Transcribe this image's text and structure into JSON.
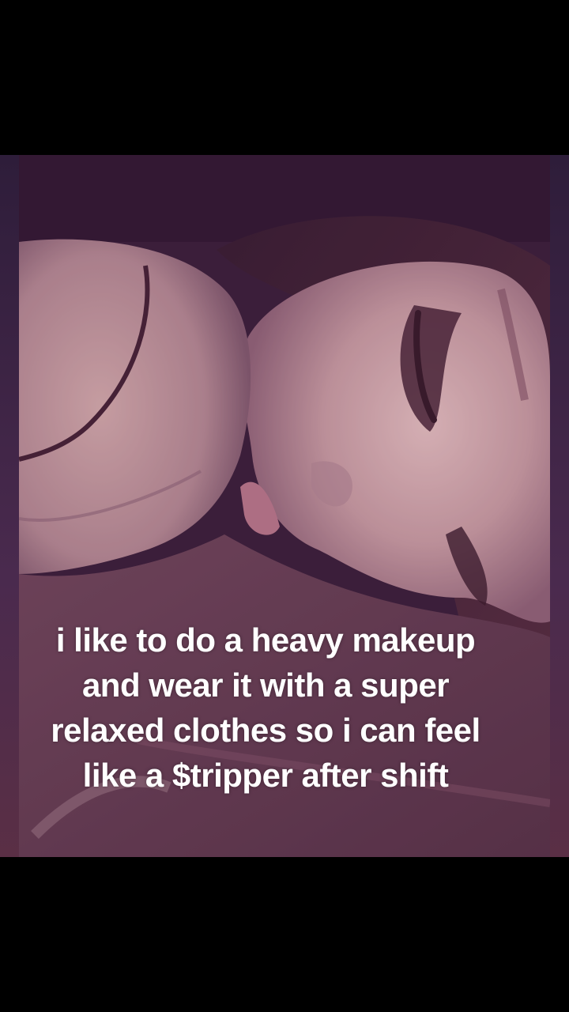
{
  "video": {
    "caption": "i like to do a heavy makeup and wear it with a super relaxed clothes so i can feel like a $tripper after shift",
    "colors": {
      "background": "#000000",
      "tint": "#5a3050",
      "caption_text": "#ffffff"
    }
  }
}
